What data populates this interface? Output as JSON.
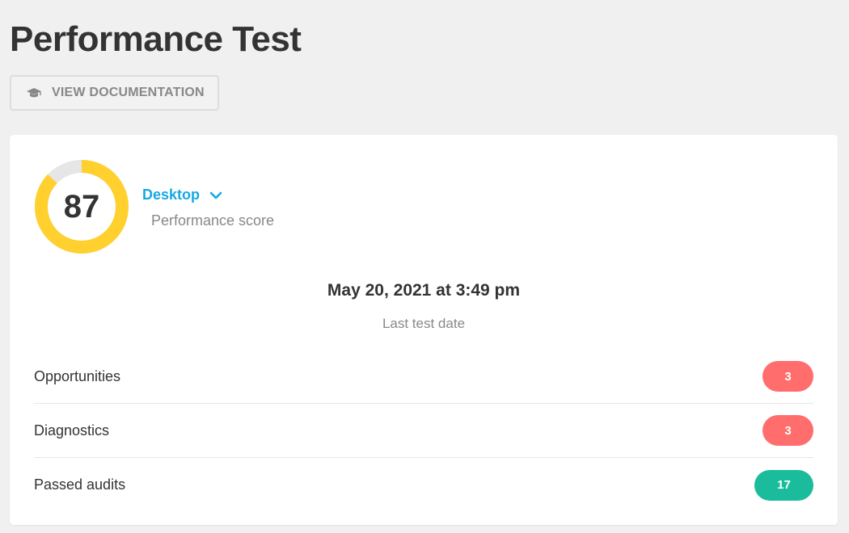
{
  "page": {
    "title": "Performance Test"
  },
  "toolbar": {
    "doc_button_label": "VIEW DOCUMENTATION",
    "doc_button_icon": "graduation-cap-icon"
  },
  "summary": {
    "score": "87",
    "score_fraction": 0.87,
    "device": "Desktop",
    "device_icon": "chevron-down-icon",
    "score_label": "Performance score",
    "date": "May 20, 2021 at 3:49 pm",
    "date_label": "Last test date"
  },
  "audits": [
    {
      "name": "Opportunities",
      "count": "3",
      "status": "warning"
    },
    {
      "name": "Diagnostics",
      "count": "3",
      "status": "warning"
    },
    {
      "name": "Passed audits",
      "count": "17",
      "status": "success"
    }
  ],
  "colors": {
    "gauge": "#ffd02e",
    "gauge_track": "#e6e6e6",
    "accent": "#17a8e3",
    "warning": "#ff6d6d",
    "success": "#1abc9c"
  }
}
